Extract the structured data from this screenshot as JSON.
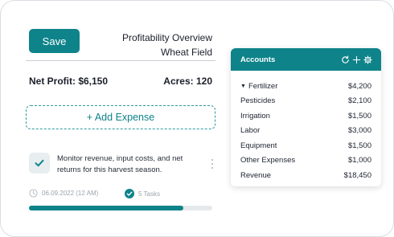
{
  "toolbar": {
    "save_label": "Save"
  },
  "header": {
    "title_line1": "Profitability Overview",
    "title_line2": "Wheat Field"
  },
  "summary": {
    "net_profit": "Net Profit: $6,150",
    "acres": "Acres: 120"
  },
  "add_expense_label": "+ Add Expense",
  "task": {
    "text": "Monitor revenue, input costs, and net returns for this harvest season.",
    "date": "06.09.2022 (12 AM)",
    "tasks_count": "5 Tasks",
    "progress": 0.84
  },
  "accounts": {
    "title": "Accounts",
    "items": [
      {
        "label": "Fertilizer",
        "value": "$4,200",
        "expanded": true
      },
      {
        "label": "Pesticides",
        "value": "$2,100"
      },
      {
        "label": "Irrigation",
        "value": "$1,500"
      },
      {
        "label": "Labor",
        "value": "$3,000"
      },
      {
        "label": "Equipment",
        "value": "$1,500"
      },
      {
        "label": "Other Expenses",
        "value": "$1,000"
      },
      {
        "label": "Revenue",
        "value": "$18,450"
      }
    ]
  },
  "colors": {
    "accent": "#0e838a",
    "card_border": "#d9dde2"
  },
  "icons": [
    "check-icon",
    "kebab-icon",
    "clock-icon",
    "check-circle-icon",
    "refresh-icon",
    "plus-icon",
    "gear-icon",
    "caret-down-icon"
  ]
}
